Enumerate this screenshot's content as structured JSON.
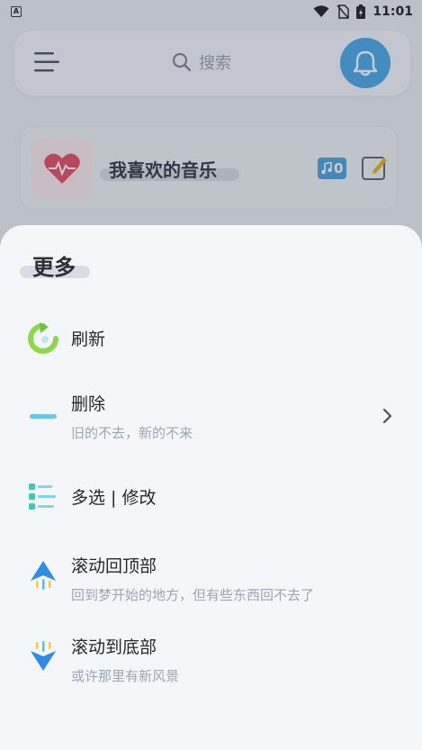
{
  "status_bar": {
    "app_badge": "A",
    "time": "11:01"
  },
  "header": {
    "search_placeholder": "搜索"
  },
  "favorites": {
    "title": "我喜欢的音乐",
    "count": "0"
  },
  "sheet": {
    "title": "更多",
    "items": [
      {
        "label": "刷新",
        "subtitle": "",
        "icon": "refresh-icon"
      },
      {
        "label": "删除",
        "subtitle": "旧的不去，新的不来",
        "icon": "delete-line-icon"
      },
      {
        "label": "多选 | 修改",
        "subtitle": "",
        "icon": "multi-select-icon"
      },
      {
        "label": "滚动回顶部",
        "subtitle": "回到梦开始的地方，但有些东西回不去了",
        "icon": "scroll-top-icon"
      },
      {
        "label": "滚动到底部",
        "subtitle": "或许那里有新风景",
        "icon": "scroll-bottom-icon"
      }
    ]
  },
  "colors": {
    "accent_blue": "#44a8e8",
    "refresh_green": "#8bd94a",
    "sheet_bg": "#f4f6fa"
  }
}
